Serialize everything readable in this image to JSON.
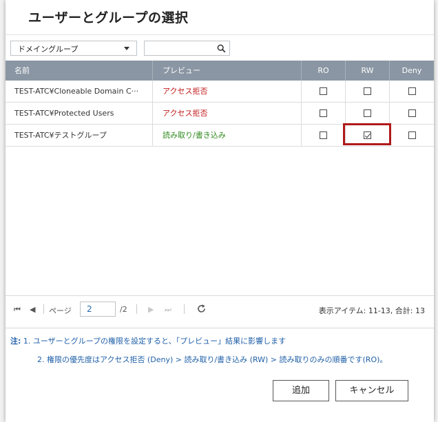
{
  "dialog": {
    "title": "ユーザーとグループの選択"
  },
  "filter": {
    "selected": "ドメイングループ",
    "search_placeholder": ""
  },
  "table": {
    "headers": [
      "名前",
      "プレビュー",
      "RO",
      "RW",
      "Deny"
    ],
    "rows": [
      {
        "name": "TEST-ATC¥Cloneable Domain C···",
        "preview": "アクセス拒否",
        "preview_status": "deny",
        "ro": false,
        "rw": false,
        "deny": false
      },
      {
        "name": "TEST-ATC¥Protected Users",
        "preview": "アクセス拒否",
        "preview_status": "deny",
        "ro": false,
        "rw": false,
        "deny": false
      },
      {
        "name": "TEST-ATC¥テストグループ",
        "preview": "読み取り/書き込み",
        "preview_status": "rw",
        "ro": false,
        "rw": true,
        "deny": false
      }
    ]
  },
  "pager": {
    "page_label": "ページ",
    "current_page": "2",
    "total_pages": "/2",
    "display_info": "表示アイテム: 11-13, 合計: 13"
  },
  "notes": {
    "prefix": "注:",
    "line1": "1. ユーザーとグループの権限を設定すると、「プレビュー」結果に影響します",
    "line2": "2. 権限の優先度はアクセス拒否 (Deny) > 読み取り/書き込み (RW) > 読み取りのみの順番です(RO)。"
  },
  "buttons": {
    "add": "追加",
    "cancel": "キャンセル"
  },
  "colors": {
    "header_bg": "#8a96a3",
    "deny_text": "#c21a1a",
    "rw_text": "#2f8a1e",
    "highlight": "#b01919",
    "note_text": "#1f5fa8"
  }
}
